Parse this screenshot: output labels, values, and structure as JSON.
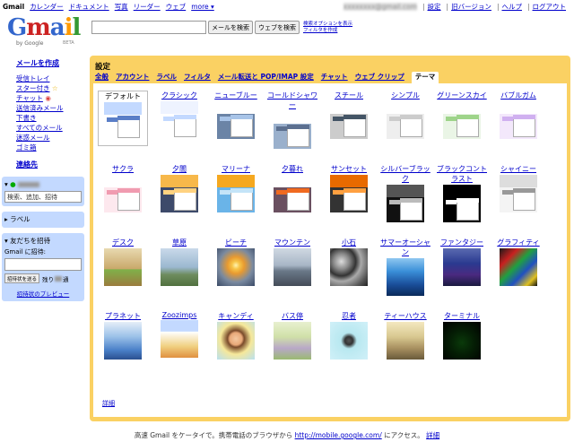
{
  "topbar": {
    "left": [
      "Gmail",
      "カレンダー",
      "ドキュメント",
      "写真",
      "リーダー",
      "ウェブ",
      "more ▾"
    ],
    "email": "xxxxxxxx@gmail.com",
    "right": [
      "設定",
      "旧バージョン",
      "ヘルプ",
      "ログアウト"
    ]
  },
  "logo": {
    "text": "Gmail",
    "sub": "by Google",
    "beta": "BETA"
  },
  "search": {
    "placeholder": "",
    "mail_button": "メールを検索",
    "web_button": "ウェブを検索",
    "opt1": "検索オプションを表示",
    "opt2": "フィルタを作成"
  },
  "sidebar": {
    "compose": "メールを作成",
    "nav": [
      {
        "label": "受信トレイ"
      },
      {
        "label": "スター付き",
        "icon": "star-icon"
      },
      {
        "label": "チャット",
        "icon": "chat-bubble-icon"
      },
      {
        "label": "送信済みメール"
      },
      {
        "label": "下書き"
      },
      {
        "label": "すべてのメール"
      },
      {
        "label": "迷惑メール"
      },
      {
        "label": "ゴミ箱"
      }
    ],
    "contacts": "連絡先",
    "chat_box": {
      "toggle": "▾",
      "status": "●",
      "search_placeholder": "検索、追加、招待"
    },
    "labels_box": {
      "toggle": "▸",
      "label": "ラベル"
    },
    "invite_box": {
      "toggle": "▾",
      "title": "友だちを招待",
      "prompt": "Gmail に招待:",
      "send_button": "招待状を送る",
      "remaining_pre": "残り",
      "remaining_post": "通",
      "preview": "招待状のプレビュー"
    }
  },
  "settings": {
    "title": "設定",
    "tabs": [
      "全般",
      "アカウント",
      "ラベル",
      "フィルタ",
      "メール転送と POP/IMAP 設定",
      "チャット",
      "ウェブ クリップ",
      "テーマ"
    ],
    "active_tab": "テーマ",
    "more_link": "詳細",
    "themes": [
      {
        "name": "デフォルト",
        "type": "ui",
        "head": "#c3d9ff",
        "body": "#ffffff",
        "acc": "#5a7ec7",
        "selected": true
      },
      {
        "name": "クラシック",
        "type": "ui",
        "head": "#eef3ff",
        "body": "#ffffff",
        "acc": "#c3d9ff"
      },
      {
        "name": "ニューブルー",
        "type": "ui",
        "head": "#ffffff",
        "body": "#6b84a6",
        "acc": "#a8c4e8"
      },
      {
        "name": "コールドシャワー",
        "type": "ui",
        "head": "#ffffff",
        "body": "#9ab0cc",
        "acc": "#5c7090"
      },
      {
        "name": "スチール",
        "type": "ui",
        "head": "#ffffff",
        "body": "#cccccc",
        "acc": "#445566"
      },
      {
        "name": "シンプル",
        "type": "ui",
        "head": "#ffffff",
        "body": "#eeeeee",
        "acc": "#cccccc"
      },
      {
        "name": "グリーンスカイ",
        "type": "ui",
        "head": "#ffffff",
        "body": "#eaf5e6",
        "acc": "#9ed48a"
      },
      {
        "name": "バブルガム",
        "type": "ui",
        "head": "#ffffff",
        "body": "#f3e8fb",
        "acc": "#d0b0f0"
      },
      {
        "name": "サクラ",
        "type": "ui",
        "head": "#ffffff",
        "body": "#fde8ee",
        "acc": "#f09bb0"
      },
      {
        "name": "夕闇",
        "type": "ui",
        "head": "#f7b84a",
        "body": "#3d4a6a",
        "acc": "#ffd280"
      },
      {
        "name": "マリーナ",
        "type": "ui",
        "head": "#f5a820",
        "body": "#6ab4e8",
        "acc": "#c4e4f8"
      },
      {
        "name": "夕暮れ",
        "type": "ui",
        "head": "#ffffff",
        "body": "#6a5060",
        "acc": "#f06a20"
      },
      {
        "name": "サンセット",
        "type": "ui",
        "head": "#e86a00",
        "body": "#333333",
        "acc": "#ffa040"
      },
      {
        "name": "シルバーブラック",
        "type": "ui",
        "head": "#555555",
        "body": "#111111",
        "acc": "#bbbbbb"
      },
      {
        "name": "ブラックコントラスト",
        "type": "ui",
        "head": "#000000",
        "body": "#000000",
        "acc": "#ffffff"
      },
      {
        "name": "シャイニー",
        "type": "ui",
        "head": "#dddddd",
        "body": "#f4f4f4",
        "acc": "#999999"
      },
      {
        "name": "デスク",
        "type": "pic",
        "bg": "linear-gradient(180deg,#e8d9b0 0%,#c9a86a 55%,#7fb14a 56%,#9b7b3e 100%)"
      },
      {
        "name": "草原",
        "type": "pic",
        "bg": "linear-gradient(180deg,#c9d9ea 0%,#9bb8d0 50%,#6e8c5e 70%,#51713f 100%)"
      },
      {
        "name": "ビーチ",
        "type": "pic",
        "bg": "radial-gradient(circle at 50% 45%,#fff3b0 0,#f7c447 14%,#e89a30 30%,#7a8aa0 60%,#3a4a66 100%)"
      },
      {
        "name": "マウンテン",
        "type": "pic",
        "bg": "linear-gradient(180deg,#cfd8e2 0%,#a8b6c6 45%,#6a7888 60%,#444c58 100%)"
      },
      {
        "name": "小石",
        "type": "pic",
        "bg": "radial-gradient(circle at 30% 35%,#ddd 0,#888 22%,#333 40%,#aaa 55%,#555 80%,#222 100%)"
      },
      {
        "name": "サマーオーシャン",
        "type": "pic",
        "bg": "linear-gradient(180deg,#8fc7f0 0%,#3a8fd8 35%,#1a4e9a 70%,#0a2a5a 100%)"
      },
      {
        "name": "ファンタジー",
        "type": "pic",
        "bg": "linear-gradient(180deg,#5a6ab0 0%,#2a3a90 40%,#4a2a80 70%,#1a1a40 100%)"
      },
      {
        "name": "グラフィティ",
        "type": "pic",
        "bg": "linear-gradient(135deg,#1a1a1a 0%,#c82020 25%,#20a040 45%,#2050c0 65%,#e0c020 85%,#111 100%)"
      },
      {
        "name": "プラネット",
        "type": "pic",
        "bg": "linear-gradient(180deg,#e6eef8 0%,#9ac0e8 40%,#4a80c8 75%,#2a5090 100%)"
      },
      {
        "name": "Zoozimps",
        "type": "pic",
        "bg": "linear-gradient(180deg,#c3d9ff 0%,#c3d9ff 30%,#ffffff 31%,#f0d080 70%,#e09040 100%)"
      },
      {
        "name": "キャンディ",
        "type": "pic",
        "bg": "radial-gradient(circle at 50% 45%,#f4c8a0 0,#e8a878 22%,#7a4a2a 30%,#f6e89a 55%,#b8e0f0 100%)"
      },
      {
        "name": "バス停",
        "type": "pic",
        "bg": "linear-gradient(180deg,#e8f0d0 0%,#d0e0a8 40%,#b8a8c8 70%,#9aba70 100%)"
      },
      {
        "name": "忍者",
        "type": "pic",
        "bg": "radial-gradient(circle at 50% 50%,#555 0,#333 15%,#b8e8f0 30%,#d0f0f8 100%)"
      },
      {
        "name": "ティーハウス",
        "type": "pic",
        "bg": "linear-gradient(180deg,#f4e8c0 0%,#d8c890 40%,#a89060 70%,#6a5a3a 100%)"
      },
      {
        "name": "ターミナル",
        "type": "pic",
        "bg": "radial-gradient(circle at 50% 55%,#0a3a0a 0,#052005 40%,#000 100%)"
      }
    ]
  },
  "footer": {
    "pre": "高速 Gmail をケータイで。携帯電話のブラウザから",
    "url": "http://mobile.google.com/",
    "post": "にアクセス。",
    "more": "詳細"
  }
}
